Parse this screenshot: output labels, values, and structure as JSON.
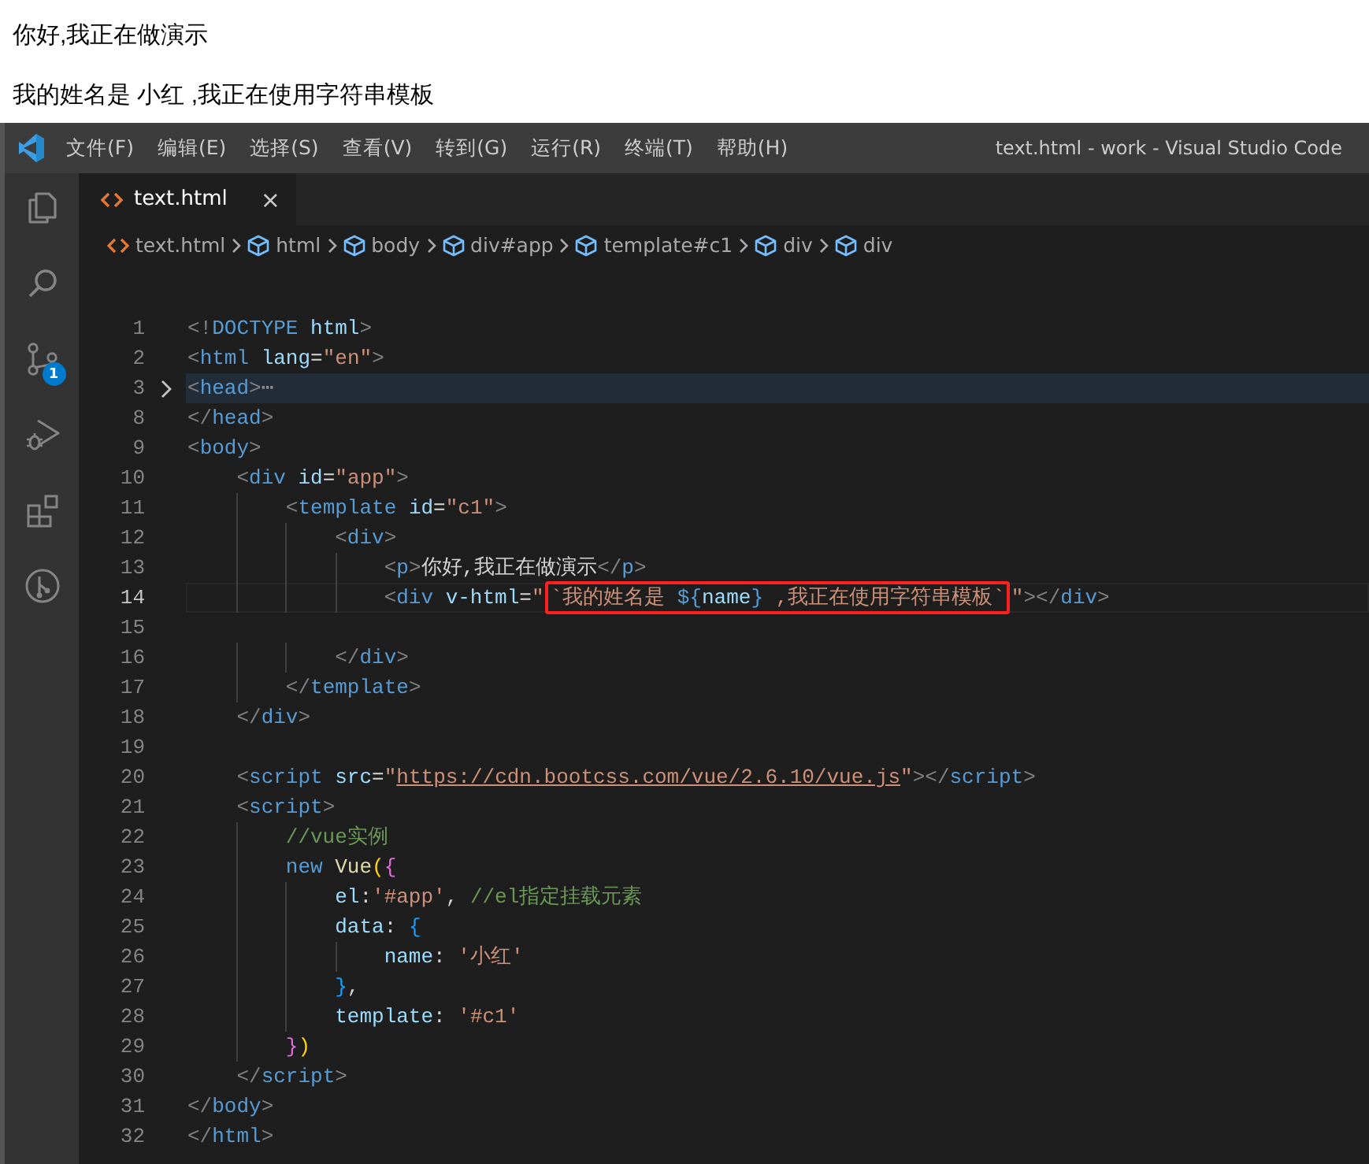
{
  "preview": {
    "lines": [
      "你好,我正在做演示",
      "我的姓名是 小红 ,我正在使用字符串模板"
    ]
  },
  "window": {
    "title": "text.html - work - Visual Studio Code"
  },
  "menu": [
    "文件(F)",
    "编辑(E)",
    "选择(S)",
    "查看(V)",
    "转到(G)",
    "运行(R)",
    "终端(T)",
    "帮助(H)"
  ],
  "activity_bar": [
    {
      "kind": "files"
    },
    {
      "kind": "search"
    },
    {
      "kind": "source-control",
      "badge": "1"
    },
    {
      "kind": "run-debug"
    },
    {
      "kind": "extensions"
    },
    {
      "kind": "git-graph"
    }
  ],
  "tabs": [
    {
      "label": "text.html",
      "selected": true,
      "close": "×"
    }
  ],
  "breadcrumb": [
    {
      "kind": "file",
      "label": "text.html"
    },
    {
      "kind": "element",
      "label": "html"
    },
    {
      "kind": "element",
      "label": "body"
    },
    {
      "kind": "element",
      "label": "div#app"
    },
    {
      "kind": "element",
      "label": "template#c1"
    },
    {
      "kind": "element",
      "label": "div"
    },
    {
      "kind": "element",
      "label": "div"
    }
  ],
  "code": [
    {
      "number": "1",
      "folded": false,
      "current": false,
      "tokens": [
        {
          "kind": "punct",
          "text": "<!"
        },
        {
          "kind": "tag",
          "text": "DOCTYPE"
        },
        {
          "kind": "attr",
          "text": " html"
        },
        {
          "kind": "punct",
          "text": ">"
        }
      ]
    },
    {
      "number": "2",
      "folded": false,
      "current": false,
      "tokens": [
        {
          "kind": "punct",
          "text": "<"
        },
        {
          "kind": "tag",
          "text": "html"
        },
        {
          "kind": "attr",
          "text": " lang"
        },
        {
          "kind": "plain",
          "text": "="
        },
        {
          "kind": "string",
          "text": "\"en\""
        },
        {
          "kind": "punct",
          "text": ">"
        }
      ]
    },
    {
      "number": "3",
      "folded": true,
      "current": false,
      "tokens": [
        {
          "kind": "punct",
          "text": "<"
        },
        {
          "kind": "tag",
          "text": "head"
        },
        {
          "kind": "punct",
          "text": ">"
        },
        {
          "kind": "fold",
          "text": "⋯"
        }
      ]
    },
    {
      "number": "8",
      "folded": false,
      "current": false,
      "tokens": [
        {
          "kind": "punct",
          "text": "</"
        },
        {
          "kind": "tag",
          "text": "head"
        },
        {
          "kind": "punct",
          "text": ">"
        }
      ]
    },
    {
      "number": "9",
      "folded": false,
      "current": false,
      "tokens": [
        {
          "kind": "punct",
          "text": "<"
        },
        {
          "kind": "tag",
          "text": "body"
        },
        {
          "kind": "punct",
          "text": ">"
        }
      ]
    },
    {
      "number": "10",
      "folded": false,
      "current": false,
      "tokens": [
        {
          "kind": "punct",
          "text": "    <"
        },
        {
          "kind": "tag",
          "text": "div"
        },
        {
          "kind": "attr",
          "text": " id"
        },
        {
          "kind": "plain",
          "text": "="
        },
        {
          "kind": "string",
          "text": "\"app\""
        },
        {
          "kind": "punct",
          "text": ">"
        }
      ]
    },
    {
      "number": "11",
      "folded": false,
      "current": false,
      "tokens": [
        {
          "kind": "punct",
          "text": "        <"
        },
        {
          "kind": "tag",
          "text": "template"
        },
        {
          "kind": "attr",
          "text": " id"
        },
        {
          "kind": "plain",
          "text": "="
        },
        {
          "kind": "string",
          "text": "\"c1\""
        },
        {
          "kind": "punct",
          "text": ">"
        }
      ]
    },
    {
      "number": "12",
      "folded": false,
      "current": false,
      "tokens": [
        {
          "kind": "punct",
          "text": "            <"
        },
        {
          "kind": "tag",
          "text": "div"
        },
        {
          "kind": "punct",
          "text": ">"
        }
      ]
    },
    {
      "number": "13",
      "folded": false,
      "current": false,
      "tokens": [
        {
          "kind": "punct",
          "text": "                <"
        },
        {
          "kind": "tag",
          "text": "p"
        },
        {
          "kind": "punct",
          "text": ">"
        },
        {
          "kind": "plain",
          "text": "你好,我正在做演示"
        },
        {
          "kind": "punct",
          "text": "</"
        },
        {
          "kind": "tag",
          "text": "p"
        },
        {
          "kind": "punct",
          "text": ">"
        }
      ]
    },
    {
      "number": "14",
      "folded": false,
      "current": true,
      "tokens": [
        {
          "kind": "punct",
          "text": "                <"
        },
        {
          "kind": "tag",
          "text": "div"
        },
        {
          "kind": "attr",
          "text": " v-html"
        },
        {
          "kind": "plain",
          "text": "="
        },
        {
          "kind": "string",
          "text": "\""
        },
        {
          "kind": "box",
          "tokens": [
            {
              "kind": "string",
              "text": "`我的姓名是 "
            },
            {
              "kind": "tag",
              "text": "${"
            },
            {
              "kind": "attr",
              "text": "name"
            },
            {
              "kind": "tag",
              "text": "}"
            },
            {
              "kind": "string",
              "text": " ,我正在使用字符串模板`"
            }
          ]
        },
        {
          "kind": "string",
          "text": "\""
        },
        {
          "kind": "punct",
          "text": "></"
        },
        {
          "kind": "tag",
          "text": "div"
        },
        {
          "kind": "punct",
          "text": ">"
        }
      ]
    },
    {
      "number": "15",
      "folded": false,
      "current": false
    },
    {
      "number": "16",
      "folded": false,
      "current": false,
      "tokens": [
        {
          "kind": "punct",
          "text": "            </"
        },
        {
          "kind": "tag",
          "text": "div"
        },
        {
          "kind": "punct",
          "text": ">"
        }
      ]
    },
    {
      "number": "17",
      "folded": false,
      "current": false,
      "tokens": [
        {
          "kind": "punct",
          "text": "        </"
        },
        {
          "kind": "tag",
          "text": "template"
        },
        {
          "kind": "punct",
          "text": ">"
        }
      ]
    },
    {
      "number": "18",
      "folded": false,
      "current": false,
      "tokens": [
        {
          "kind": "punct",
          "text": "    </"
        },
        {
          "kind": "tag",
          "text": "div"
        },
        {
          "kind": "punct",
          "text": ">"
        }
      ]
    },
    {
      "number": "19",
      "folded": false,
      "current": false
    },
    {
      "number": "20",
      "folded": false,
      "current": false,
      "tokens": [
        {
          "kind": "punct",
          "text": "    <"
        },
        {
          "kind": "tag",
          "text": "script"
        },
        {
          "kind": "attr",
          "text": " src"
        },
        {
          "kind": "plain",
          "text": "="
        },
        {
          "kind": "string",
          "text": "\""
        },
        {
          "kind": "link",
          "text": "https://cdn.bootcss.com/vue/2.6.10/vue.js"
        },
        {
          "kind": "string",
          "text": "\""
        },
        {
          "kind": "punct",
          "text": "></"
        },
        {
          "kind": "tag",
          "text": "script"
        },
        {
          "kind": "punct",
          "text": ">"
        }
      ]
    },
    {
      "number": "21",
      "folded": false,
      "current": false,
      "tokens": [
        {
          "kind": "punct",
          "text": "    <"
        },
        {
          "kind": "tag",
          "text": "script"
        },
        {
          "kind": "punct",
          "text": ">"
        }
      ]
    },
    {
      "number": "22",
      "folded": false,
      "current": false,
      "tokens": [
        {
          "kind": "comment",
          "text": "        //vue实例"
        }
      ]
    },
    {
      "number": "23",
      "folded": false,
      "current": false,
      "tokens": [
        {
          "kind": "keyword",
          "text": "        new"
        },
        {
          "kind": "function",
          "text": " Vue"
        },
        {
          "kind": "bracket1",
          "text": "("
        },
        {
          "kind": "bracket2",
          "text": "{"
        }
      ]
    },
    {
      "number": "24",
      "folded": false,
      "current": false,
      "tokens": [
        {
          "kind": "attr",
          "text": "            el"
        },
        {
          "kind": "plain",
          "text": ":"
        },
        {
          "kind": "string",
          "text": "'#app'"
        },
        {
          "kind": "plain",
          "text": ", "
        },
        {
          "kind": "comment",
          "text": "//el指定挂载元素"
        }
      ]
    },
    {
      "number": "25",
      "folded": false,
      "current": false,
      "tokens": [
        {
          "kind": "attr",
          "text": "            data"
        },
        {
          "kind": "plain",
          "text": ": "
        },
        {
          "kind": "bracket3",
          "text": "{"
        }
      ]
    },
    {
      "number": "26",
      "folded": false,
      "current": false,
      "tokens": [
        {
          "kind": "attr",
          "text": "                name"
        },
        {
          "kind": "plain",
          "text": ": "
        },
        {
          "kind": "string",
          "text": "'小红'"
        }
      ]
    },
    {
      "number": "27",
      "folded": false,
      "current": false,
      "tokens": [
        {
          "kind": "bracket3",
          "text": "            }"
        },
        {
          "kind": "plain",
          "text": ","
        }
      ]
    },
    {
      "number": "28",
      "folded": false,
      "current": false,
      "tokens": [
        {
          "kind": "attr",
          "text": "            template"
        },
        {
          "kind": "plain",
          "text": ": "
        },
        {
          "kind": "string",
          "text": "'#c1'"
        }
      ]
    },
    {
      "number": "29",
      "folded": false,
      "current": false,
      "tokens": [
        {
          "kind": "bracket2",
          "text": "        }"
        },
        {
          "kind": "bracket1",
          "text": ")"
        }
      ]
    },
    {
      "number": "30",
      "folded": false,
      "current": false,
      "tokens": [
        {
          "kind": "punct",
          "text": "    </"
        },
        {
          "kind": "tag",
          "text": "script"
        },
        {
          "kind": "punct",
          "text": ">"
        }
      ]
    },
    {
      "number": "31",
      "folded": false,
      "current": false,
      "tokens": [
        {
          "kind": "punct",
          "text": "</"
        },
        {
          "kind": "tag",
          "text": "body"
        },
        {
          "kind": "punct",
          "text": ">"
        }
      ]
    },
    {
      "number": "32",
      "folded": false,
      "current": false,
      "tokens": [
        {
          "kind": "punct",
          "text": "</"
        },
        {
          "kind": "tag",
          "text": "html"
        },
        {
          "kind": "punct",
          "text": ">"
        }
      ]
    }
  ]
}
